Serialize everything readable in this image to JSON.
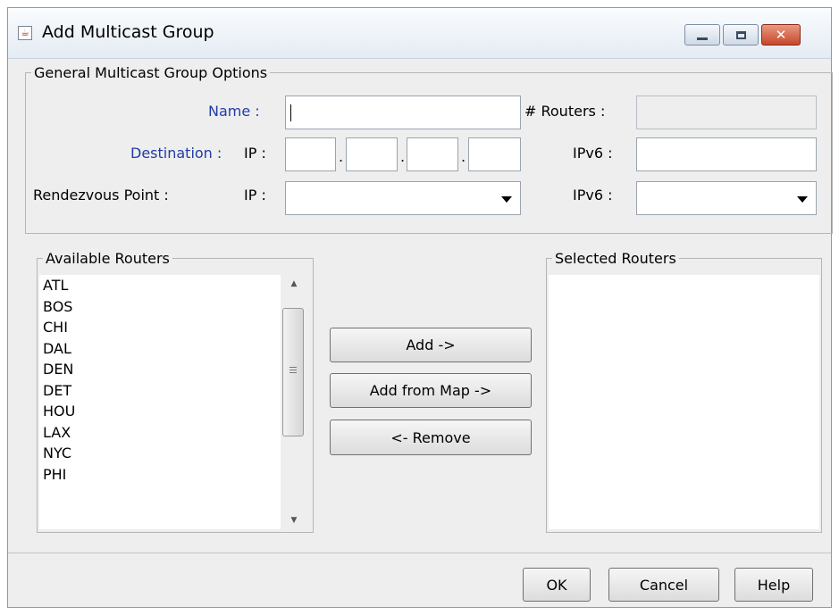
{
  "window": {
    "title": "Add Multicast Group"
  },
  "general": {
    "legend": "General Multicast Group Options",
    "name_label": "Name :",
    "name_value": "",
    "routers_label": "# Routers :",
    "routers_value": "",
    "destination_label": "Destination :",
    "ip_label": "IP :",
    "ipv6_label": "IPv6 :",
    "destination_octets": [
      "",
      "",
      "",
      ""
    ],
    "octet_separator": ".",
    "destination_ipv6_value": "",
    "rendezvous_label": "Rendezvous Point :",
    "rp_ip_label": "IP :",
    "rp_ip_value": "",
    "rp_ipv6_label": "IPv6 :",
    "rp_ipv6_value": ""
  },
  "available_routers": {
    "legend": "Available Routers",
    "items": [
      "ATL",
      "BOS",
      "CHI",
      "DAL",
      "DEN",
      "DET",
      "HOU",
      "LAX",
      "NYC",
      "PHI"
    ]
  },
  "selected_routers": {
    "legend": "Selected Routers",
    "items": []
  },
  "actions": {
    "add": "Add ->",
    "add_from_map": "Add from Map ->",
    "remove": "<- Remove"
  },
  "footer": {
    "ok": "OK",
    "cancel": "Cancel",
    "help": "Help"
  },
  "icons": {
    "app": "java-app-icon",
    "minimize": "minimize-icon",
    "maximize": "maximize-icon",
    "close": "close-icon",
    "dropdown": "chevron-down-icon",
    "scroll_up": "scroll-up-icon",
    "scroll_down": "scroll-down-icon"
  },
  "colors": {
    "required_label": "#1f3ca8",
    "close_button": "#c6472a"
  }
}
